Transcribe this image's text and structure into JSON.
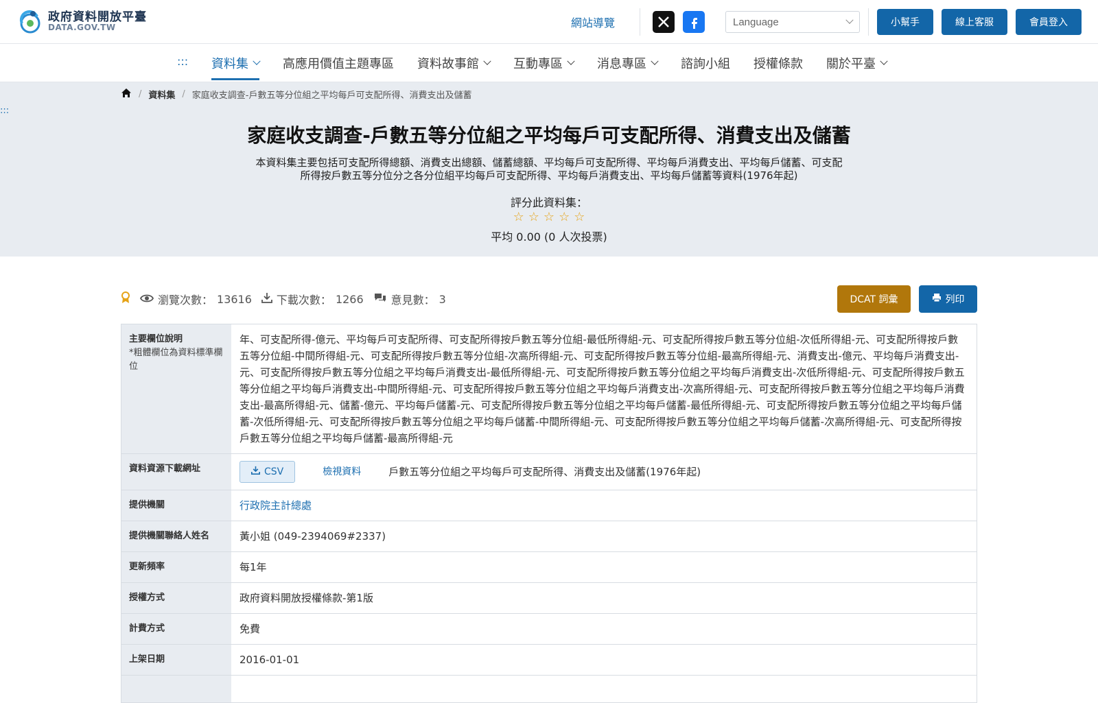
{
  "header": {
    "logo_title": "政府資料開放平臺",
    "logo_sub": "DATA.GOV.TW",
    "sitemap": "網站導覽",
    "language_placeholder": "Language",
    "buttons": [
      "小幫手",
      "線上客服",
      "會員登入"
    ]
  },
  "nav": {
    "accesskey": ":::",
    "items": [
      {
        "label": "資料集",
        "dropdown": true,
        "active": true
      },
      {
        "label": "高應用價值主題專區",
        "dropdown": false
      },
      {
        "label": "資料故事館",
        "dropdown": true
      },
      {
        "label": "互動專區",
        "dropdown": true
      },
      {
        "label": "消息專區",
        "dropdown": true
      },
      {
        "label": "諮詢小組",
        "dropdown": false
      },
      {
        "label": "授權條款",
        "dropdown": false
      },
      {
        "label": "關於平臺",
        "dropdown": true
      }
    ]
  },
  "breadcrumb": {
    "section": "資料集",
    "current": "家庭收支調查-戶數五等分位組之平均每戶可支配所得、消費支出及儲蓄"
  },
  "hero": {
    "accesskey": ":::",
    "title": "家庭收支調查-戶數五等分位組之平均每戶可支配所得、消費支出及儲蓄",
    "description": "本資料集主要包括可支配所得總額、消費支出總額、儲蓄總額、平均每戶可支配所得、平均每戶消費支出、平均每戶儲蓄、可支配所得按戶數五等分位分之各分位組平均每戶可支配所得、平均每戶消費支出、平均每戶儲蓄等資料(1976年起)",
    "rate_label": "評分此資料集：",
    "rating": 0,
    "rating_avg": "平均 0.00 (0 人次投票)"
  },
  "stats": {
    "views_label": "瀏覽次數：",
    "views": "13616",
    "downloads_label": "下載次數：",
    "downloads": "1266",
    "comments_label": "意見數：",
    "comments": "3",
    "dcat_button": "DCAT 詞彙",
    "print_button": "列印"
  },
  "meta": {
    "fields_label": "主要欄位說明",
    "fields_hint": "*粗體欄位為資料標準欄位",
    "fields_value": "年、可支配所得-億元、平均每戶可支配所得、可支配所得按戶數五等分位組-最低所得組-元、可支配所得按戶數五等分位組-次低所得組-元、可支配所得按戶數五等分位組-中間所得組-元、可支配所得按戶數五等分位組-次高所得組-元、可支配所得按戶數五等分位組-最高所得組-元、消費支出-億元、平均每戶消費支出-元、可支配所得按戶數五等分位組之平均每戶消費支出-最低所得組-元、可支配所得按戶數五等分位組之平均每戶消費支出-次低所得組-元、可支配所得按戶數五等分位組之平均每戶消費支出-中間所得組-元、可支配所得按戶數五等分位組之平均每戶消費支出-次高所得組-元、可支配所得按戶數五等分位組之平均每戶消費支出-最高所得組-元、儲蓄-億元、平均每戶儲蓄-元、可支配所得按戶數五等分位組之平均每戶儲蓄-最低所得組-元、可支配所得按戶數五等分位組之平均每戶儲蓄-次低所得組-元、可支配所得按戶數五等分位組之平均每戶儲蓄-中間所得組-元、可支配所得按戶數五等分位組之平均每戶儲蓄-次高所得組-元、可支配所得按戶數五等分位組之平均每戶儲蓄-最高所得組-元",
    "download_label": "資料資源下載網址",
    "csv_button": "CSV",
    "view_data": "檢視資料",
    "resource_name": "戶數五等分位組之平均每戶可支配所得、消費支出及儲蓄(1976年起)",
    "provider_label": "提供機關",
    "provider": "行政院主計總處",
    "contact_label": "提供機關聯絡人姓名",
    "contact": "黃小姐 (049-2394069#2337)",
    "frequency_label": "更新頻率",
    "frequency": "每1年",
    "license_label": "授權方式",
    "license": "政府資料開放授權條款-第1版",
    "fee_label": "計費方式",
    "fee": "免費",
    "published_label": "上架日期",
    "published": "2016-01-01"
  },
  "colors": {
    "primary": "#1366a8",
    "link": "#1d6fb0",
    "dcat": "#b1770b",
    "hero_bg": "#e8ecf1",
    "star": "#e6a317"
  }
}
